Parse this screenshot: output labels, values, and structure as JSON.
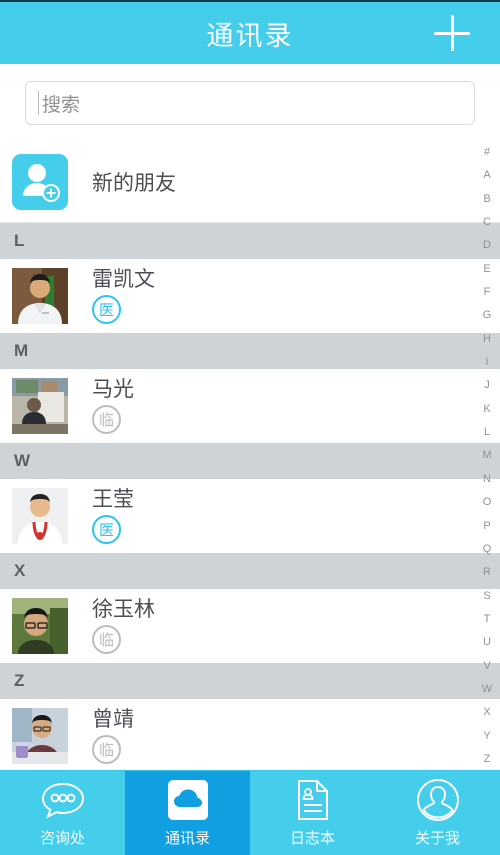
{
  "header": {
    "title": "通讯录",
    "add_icon": "plus-icon",
    "bg_color": "#45cdec"
  },
  "search": {
    "placeholder": "搜索",
    "value": ""
  },
  "new_friend": {
    "label": "新的朋友",
    "icon": "person-add-icon"
  },
  "sections": [
    {
      "letter": "L",
      "contacts": [
        {
          "name": "雷凯文",
          "badge": "医",
          "badge_type": "doctor",
          "badge_color": "#29c5f6",
          "photo": "photo-doctor-white-coat"
        }
      ]
    },
    {
      "letter": "M",
      "contacts": [
        {
          "name": "马光",
          "badge": "临",
          "badge_type": "clinical",
          "badge_color": "#b9bdc0",
          "photo": "photo-man-at-desk"
        }
      ]
    },
    {
      "letter": "W",
      "contacts": [
        {
          "name": "王莹",
          "badge": "医",
          "badge_type": "doctor",
          "badge_color": "#29c5f6",
          "photo": "photo-doctor-stethoscope"
        }
      ]
    },
    {
      "letter": "X",
      "contacts": [
        {
          "name": "徐玉林",
          "badge": "临",
          "badge_type": "clinical",
          "badge_color": "#b9bdc0",
          "photo": "photo-man-glasses-outdoor"
        }
      ]
    },
    {
      "letter": "Z",
      "contacts": [
        {
          "name": "曾靖",
          "badge": "临",
          "badge_type": "clinical",
          "badge_color": "#b9bdc0",
          "photo": "photo-man-with-cup"
        }
      ]
    }
  ],
  "index_rail": [
    "#",
    "A",
    "B",
    "C",
    "D",
    "E",
    "F",
    "G",
    "H",
    "I",
    "J",
    "K",
    "L",
    "M",
    "N",
    "O",
    "P",
    "Q",
    "R",
    "S",
    "T",
    "U",
    "V",
    "W",
    "X",
    "Y",
    "Z"
  ],
  "bottom_nav": {
    "active_index": 1,
    "active_color": "#109fe0",
    "items": [
      {
        "label": "咨询处",
        "icon": "chat-bubble-icon"
      },
      {
        "label": "通讯录",
        "icon": "cloud-icon"
      },
      {
        "label": "日志本",
        "icon": "document-icon"
      },
      {
        "label": "关于我",
        "icon": "person-circle-icon"
      }
    ]
  }
}
